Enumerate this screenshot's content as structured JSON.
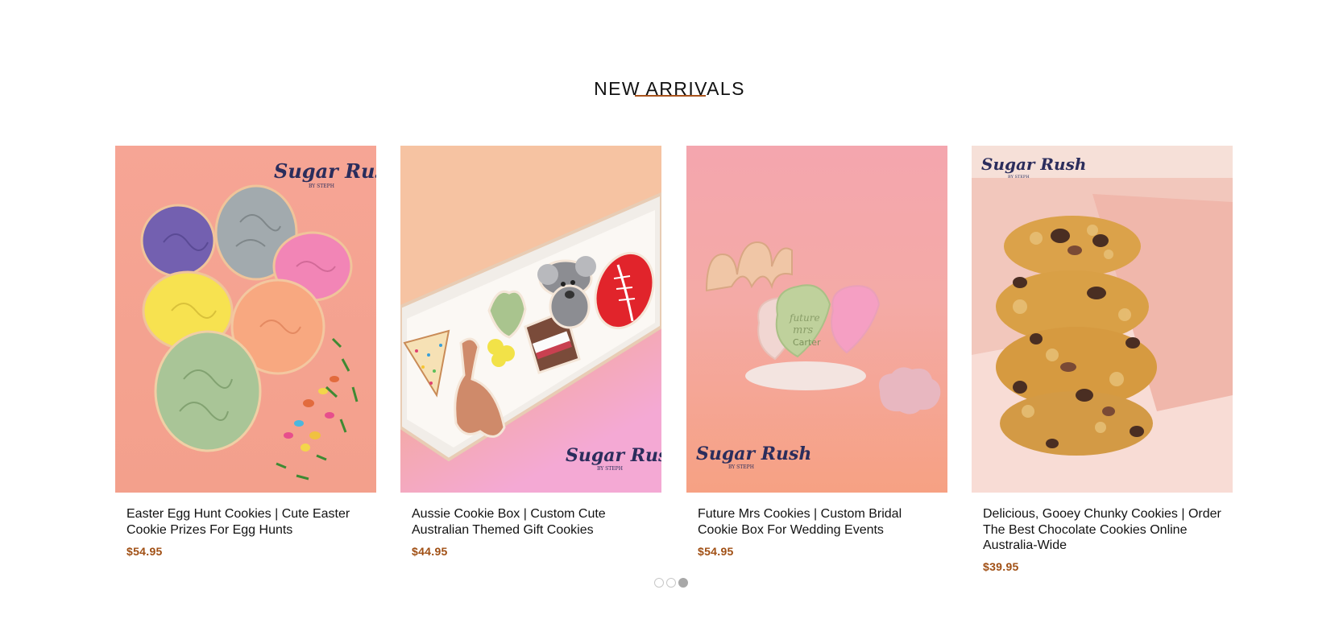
{
  "section": {
    "heading": "NEW ARRIVALS"
  },
  "products": [
    {
      "title": "Easter Egg Hunt Cookies | Cute Easter Cookie Prizes For Egg Hunts",
      "price": "$54.95",
      "image_alt": "Easter egg shaped cookies"
    },
    {
      "title": "Aussie Cookie Box | Custom Cute Australian Themed Gift Cookies",
      "price": "$44.95",
      "image_alt": "Box of Australian themed cookies"
    },
    {
      "title": "Future Mrs Cookies | Custom Bridal Cookie Box For Wedding Events",
      "price": "$54.95",
      "image_alt": "Heart shaped bridal cookies"
    },
    {
      "title": "Delicious, Gooey Chunky Cookies | Order The Best Chocolate Cookies Online Australia-Wide",
      "price": "$39.95",
      "image_alt": "Stack of chunky chocolate chip cookies"
    }
  ],
  "brand": {
    "logo_main": "Sugar Rush",
    "logo_sub": "BY STEPH"
  },
  "carousel": {
    "page_count": 3,
    "active_page": 3
  },
  "colors": {
    "accent": "#a9531c",
    "price": "#a04f14",
    "logo": "#2b2d5c"
  }
}
